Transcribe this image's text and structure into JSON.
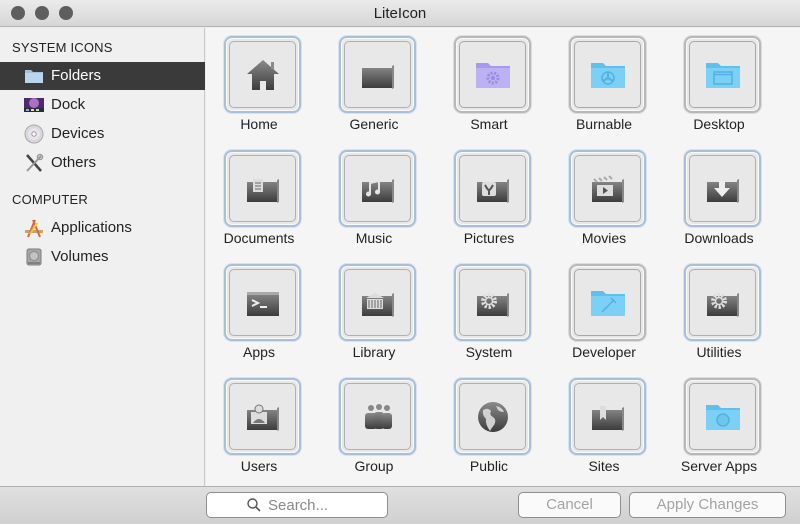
{
  "window": {
    "title": "LiteIcon"
  },
  "sidebar": {
    "sections": [
      {
        "heading": "SYSTEM ICONS",
        "items": [
          {
            "label": "Folders",
            "icon": "folder-icon",
            "selected": true
          },
          {
            "label": "Dock",
            "icon": "dock-icon",
            "selected": false
          },
          {
            "label": "Devices",
            "icon": "disc-icon",
            "selected": false
          },
          {
            "label": "Others",
            "icon": "tools-icon",
            "selected": false
          }
        ]
      },
      {
        "heading": "COMPUTER",
        "items": [
          {
            "label": "Applications",
            "icon": "applications-icon",
            "selected": false
          },
          {
            "label": "Volumes",
            "icon": "hard-drive-icon",
            "selected": false
          }
        ]
      }
    ]
  },
  "grid": {
    "items": [
      {
        "label": "Home",
        "icon": "home-icon",
        "style": "gray-glyph",
        "frame": "blue"
      },
      {
        "label": "Generic",
        "icon": "folder-icon",
        "style": "gray-glyph",
        "frame": "blue"
      },
      {
        "label": "Smart",
        "icon": "smart-folder-icon",
        "style": "purple-folder",
        "frame": "gray"
      },
      {
        "label": "Burnable",
        "icon": "burnable-folder-icon",
        "style": "blue-folder",
        "frame": "gray"
      },
      {
        "label": "Desktop",
        "icon": "desktop-folder-icon",
        "style": "blue-folder",
        "frame": "gray"
      },
      {
        "label": "Documents",
        "icon": "documents-folder-icon",
        "style": "gray-glyph",
        "frame": "blue"
      },
      {
        "label": "Music",
        "icon": "music-folder-icon",
        "style": "gray-glyph",
        "frame": "blue"
      },
      {
        "label": "Pictures",
        "icon": "pictures-folder-icon",
        "style": "gray-glyph",
        "frame": "blue"
      },
      {
        "label": "Movies",
        "icon": "movies-folder-icon",
        "style": "gray-glyph",
        "frame": "blue"
      },
      {
        "label": "Downloads",
        "icon": "downloads-folder-icon",
        "style": "gray-glyph",
        "frame": "blue"
      },
      {
        "label": "Apps",
        "icon": "terminal-icon",
        "style": "gray-glyph",
        "frame": "blue"
      },
      {
        "label": "Library",
        "icon": "library-folder-icon",
        "style": "gray-glyph",
        "frame": "blue"
      },
      {
        "label": "System",
        "icon": "system-folder-icon",
        "style": "gray-glyph",
        "frame": "blue"
      },
      {
        "label": "Developer",
        "icon": "developer-folder-icon",
        "style": "blue-folder",
        "frame": "gray"
      },
      {
        "label": "Utilities",
        "icon": "utilities-folder-icon",
        "style": "gray-glyph",
        "frame": "blue"
      },
      {
        "label": "Users",
        "icon": "users-folder-icon",
        "style": "gray-glyph",
        "frame": "blue"
      },
      {
        "label": "Group",
        "icon": "group-icon",
        "style": "gray-glyph",
        "frame": "blue"
      },
      {
        "label": "Public",
        "icon": "globe-icon",
        "style": "gray-glyph",
        "frame": "blue"
      },
      {
        "label": "Sites",
        "icon": "sites-folder-icon",
        "style": "gray-glyph",
        "frame": "blue"
      },
      {
        "label": "Server Apps",
        "icon": "server-apps-folder-icon",
        "style": "blue-folder",
        "frame": "gray"
      }
    ]
  },
  "footer": {
    "search_placeholder": "Search...",
    "search_value": "",
    "cancel_label": "Cancel",
    "apply_label": "Apply Changes",
    "buttons_enabled": false
  },
  "colors": {
    "selection_bg": "#3a3a3a",
    "frame_blue": "#a9bfd9",
    "frame_gray": "#b8b8b8",
    "blue_folder": "#7dd0f5",
    "purple_folder": "#bcb1f3"
  }
}
